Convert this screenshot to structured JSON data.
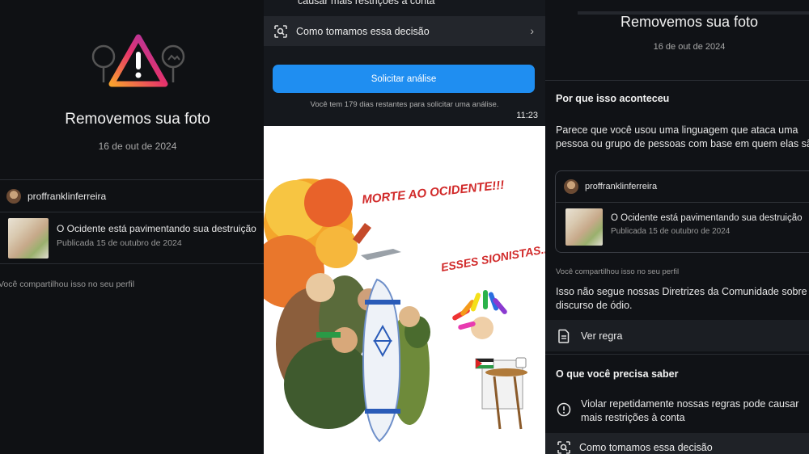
{
  "left": {
    "title": "Removemos sua foto",
    "date": "16 de out de 2024",
    "username": "proffranklinferreira",
    "post_title": "O Ocidente está pavimentando sua destruição",
    "post_date": "Publicada 15 de outubro de 2024",
    "shared_note": "Você compartilhou isso no seu perfil"
  },
  "middle": {
    "restriction_fragment": "causar mais restrições à conta",
    "decision_label": "Como tomamos essa decisão",
    "request_button": "Solicitar análise",
    "days_note": "Você tem 179 dias restantes para solicitar uma análise.",
    "time": "11:23",
    "cartoon": {
      "caption_left": "MORTE AO OCIDENTE!!!",
      "caption_right": "ESSES SIONISTAS..."
    }
  },
  "right": {
    "title": "Removemos sua foto",
    "date": "16 de out de 2024",
    "why_heading": "Por que isso aconteceu",
    "why_text": "Parece que você usou uma linguagem que ataca uma pessoa ou grupo de pessoas com base em quem elas são.",
    "username": "proffranklinferreira",
    "post_title": "O Ocidente está pavimentando sua destruição",
    "post_date": "Publicada 15 de outubro de 2024",
    "shared_note": "Você compartilhou isso no seu perfil",
    "policy_text": "Isso não segue nossas Diretrizes da Comunidade sobre discurso de ódio.",
    "see_rule": "Ver regra",
    "know_heading": "O que você precisa saber",
    "violation_text": "Violar repetidamente nossas regras pode causar mais restrições à conta",
    "decision_label": "Como tomamos essa decisão"
  },
  "icons": {
    "warning": "warning-triangle-icon",
    "document": "document-icon",
    "alert": "alert-circle-icon",
    "scan": "scan-face-icon",
    "chevron": "chevron-right-icon"
  },
  "colors": {
    "accent_button": "#1f8ef1",
    "panel_bg": "#0f1114",
    "warning_gradient": [
      "#f9a12e",
      "#e6336b",
      "#9b36b7"
    ]
  }
}
